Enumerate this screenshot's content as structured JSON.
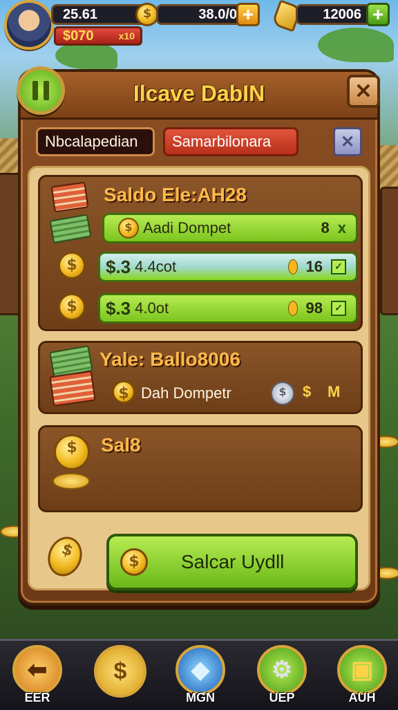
{
  "hud": {
    "stat_top": "25.61",
    "currency_red": "$070",
    "currency_red_small": "x10",
    "coins": "38.0/0",
    "gems": "12006"
  },
  "panel": {
    "title": "Ilcave DabIN",
    "tabs": [
      "Nbcalapedian",
      "Samarbilonara"
    ],
    "section1": {
      "title": "Saldo Ele:AH28",
      "rows": [
        {
          "label": "Aadi Dompet",
          "value": "8",
          "mark": "x"
        },
        {
          "price": "$.3",
          "amount": "4.4cot",
          "value": "16",
          "mark": "✓"
        },
        {
          "price": "$.3",
          "amount": "4.0ot",
          "value": "98",
          "mark": "✓"
        }
      ]
    },
    "section2": {
      "title": "Yale: Ballo8006",
      "label": "Dah Dompetr",
      "suffix_a": "$",
      "suffix_b": "M"
    },
    "section3": {
      "title": "Sal8"
    },
    "action_button": "Salcar Uydll"
  },
  "nav": [
    {
      "label": "EER",
      "icon": "back-arrow-icon"
    },
    {
      "label": "",
      "icon": "dollar-coin-icon"
    },
    {
      "label": "MGN",
      "icon": "crystal-icon"
    },
    {
      "label": "UEP",
      "icon": "gear-icon"
    },
    {
      "label": "AUH",
      "icon": "treasure-chest-icon"
    }
  ],
  "colors": {
    "panel": "#7c4116",
    "title": "#ffd24a",
    "green_button": "#7cc41e",
    "accent_red": "#b8301c"
  }
}
